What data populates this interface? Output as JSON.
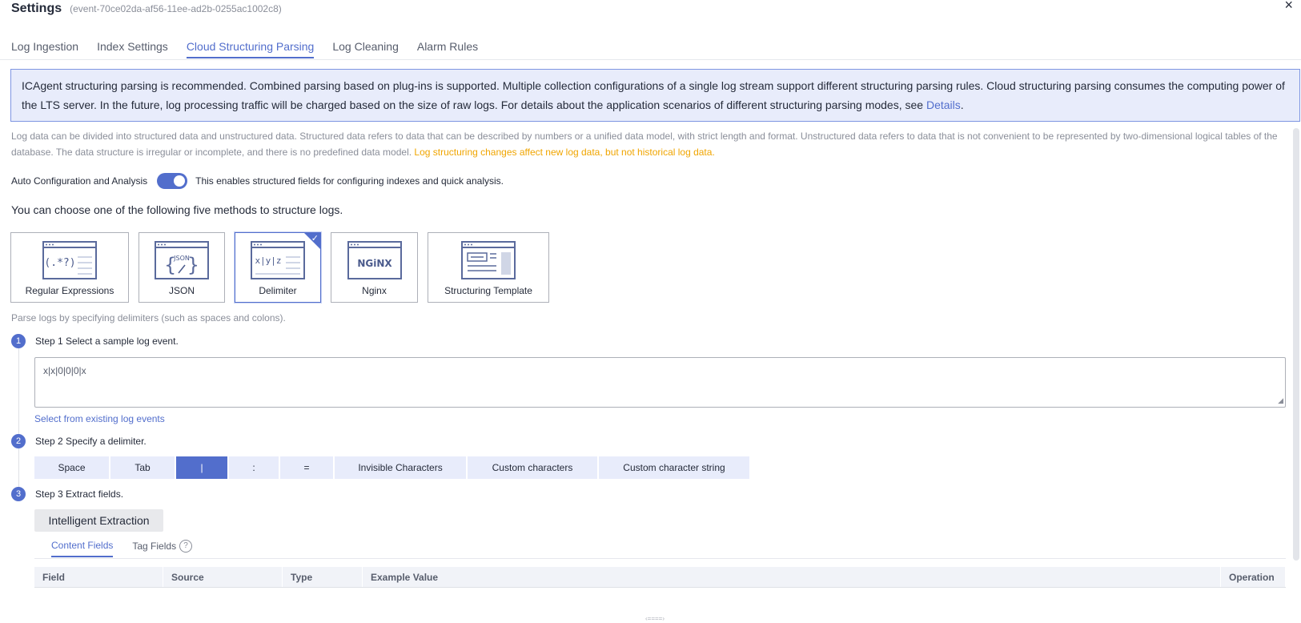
{
  "header": {
    "title": "Settings",
    "event_id": "(event-70ce02da-af56-11ee-ad2b-0255ac1002c8)",
    "close": "×"
  },
  "tabs": [
    {
      "label": "Log Ingestion"
    },
    {
      "label": "Index Settings"
    },
    {
      "label": "Cloud Structuring Parsing"
    },
    {
      "label": "Log Cleaning"
    },
    {
      "label": "Alarm Rules"
    }
  ],
  "info": {
    "text": "ICAgent structuring parsing is recommended. Combined parsing based on plug-ins is supported. Multiple collection configurations of a single log stream support different structuring parsing rules. Cloud structuring parsing consumes the computing power of the LTS server. In the future, log processing traffic will be charged based on the size of raw logs. For details about the application scenarios of different structuring parsing modes, see ",
    "link": "Details",
    "end": "."
  },
  "description": {
    "text": "Log data can be divided into structured data and unstructured data. Structured data refers to data that can be described by numbers or a unified data model, with strict length and format. Unstructured data refers to data that is not convenient to be represented by two-dimensional logical tables of the database. The data structure is irregular or incomplete, and there is no predefined data model. ",
    "warning": "Log structuring changes affect new log data, but not historical log data."
  },
  "auto_config": {
    "label": "Auto Configuration and Analysis",
    "hint": "This enables structured fields for configuring indexes and quick analysis.",
    "enabled": true
  },
  "methods": {
    "title": "You can choose one of the following five methods to structure logs.",
    "cards": [
      {
        "label": "Regular Expressions",
        "icon_text": "(.*?)"
      },
      {
        "label": "JSON",
        "icon_text": "JSON"
      },
      {
        "label": "Delimiter",
        "icon_text": "x|y|z"
      },
      {
        "label": "Nginx",
        "icon_text": "NGiNX"
      },
      {
        "label": "Structuring Template",
        "icon_text": ""
      }
    ],
    "selected": "Delimiter",
    "hint": "Parse logs by specifying delimiters (such as spaces and colons)."
  },
  "steps": {
    "step1": {
      "num": "1",
      "label": "Step 1 Select a sample log event.",
      "sample": "x|x|0|0|0|x",
      "link": "Select from existing log events"
    },
    "step2": {
      "num": "2",
      "label": "Step 2 Specify a delimiter."
    },
    "step3": {
      "num": "3",
      "label": "Step 3 Extract fields."
    }
  },
  "delimiters": [
    {
      "label": "Space"
    },
    {
      "label": "Tab"
    },
    {
      "label": "|"
    },
    {
      "label": ":"
    },
    {
      "label": "="
    },
    {
      "label": "Invisible Characters"
    },
    {
      "label": "Custom characters"
    },
    {
      "label": "Custom character string"
    }
  ],
  "selected_delimiter": "|",
  "extract_button": "Intelligent Extraction",
  "subtabs": [
    {
      "label": "Content Fields"
    },
    {
      "label": "Tag Fields"
    }
  ],
  "table": {
    "columns": [
      "Field",
      "Source",
      "Type",
      "Example Value",
      "Operation"
    ]
  },
  "colors": {
    "accent": "#526ecc",
    "warning": "#f0a500",
    "info_bg": "#e8ecfb"
  }
}
